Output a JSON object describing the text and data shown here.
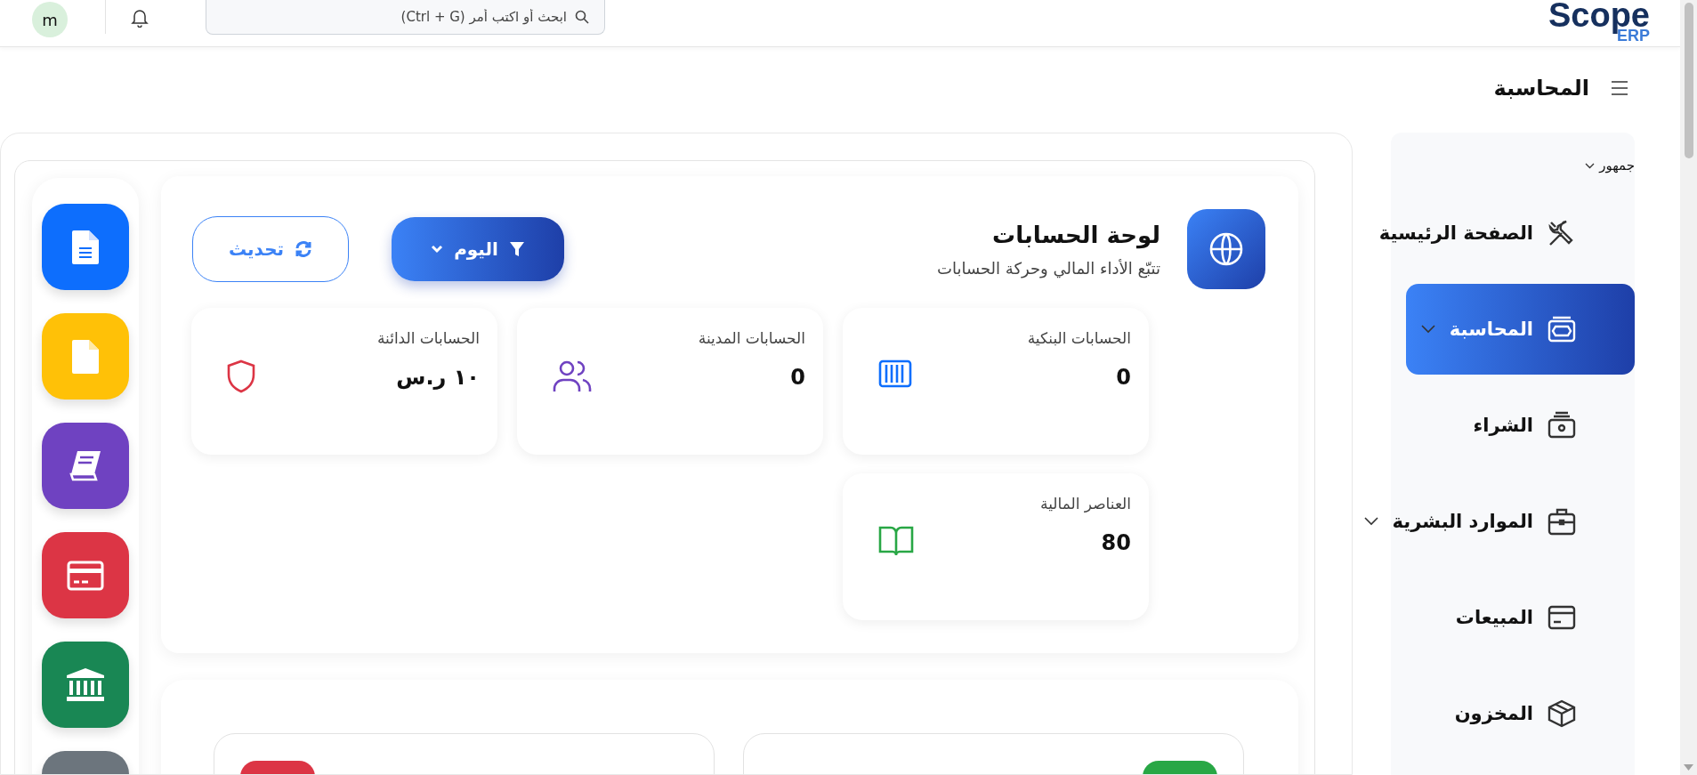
{
  "top_bar": {
    "avatar": "m",
    "search": {
      "placeholder": "ابحث أو اكتب أمر (Ctrl + G)"
    },
    "logo": {
      "name": "Scope",
      "suffix": "ERP"
    }
  },
  "page_title": "المحاسبة",
  "sidebar": {
    "workspace": "جمهور",
    "items": [
      {
        "label": "الصفحة الرئيسية",
        "selected": false,
        "expandable": false
      },
      {
        "label": "المحاسبة",
        "selected": true,
        "expandable": true
      },
      {
        "label": "الشراء",
        "selected": false,
        "expandable": false
      },
      {
        "label": "الموارد البشرية",
        "selected": false,
        "expandable": true
      },
      {
        "label": "المبيعات",
        "selected": false,
        "expandable": false
      },
      {
        "label": "المخزون",
        "selected": false,
        "expandable": false
      }
    ]
  },
  "shortcuts": [
    {
      "kind": "document",
      "color": "#0d6efd"
    },
    {
      "kind": "blank-document",
      "color": "#ffc107"
    },
    {
      "kind": "book",
      "color": "#6f42c1"
    },
    {
      "kind": "card",
      "color": "#dc3545"
    },
    {
      "kind": "bank",
      "color": "#198754"
    },
    {
      "kind": "hidden",
      "color": "#6c757d"
    }
  ],
  "dashboard": {
    "title": "لوحة الحسابات",
    "subtitle": "تتبّع الأداء المالي وحركة الحسابات",
    "filter_button": "اليوم",
    "refresh_button": "تحديث",
    "stats": [
      {
        "label": "الحسابات البنكية",
        "value": "0",
        "color": "#0d6efd"
      },
      {
        "label": "الحسابات المدينة",
        "value": "0",
        "color": "#6f42c1"
      },
      {
        "label": "الحسابات الدائنة",
        "value": "١٠ ر.س",
        "color": "#dc3545"
      },
      {
        "label": "العناصر المالية",
        "value": "80",
        "color": "#28a745"
      }
    ]
  },
  "lower_cards": [
    {
      "color": "#28a745"
    },
    {
      "color": "#dc3545"
    }
  ]
}
